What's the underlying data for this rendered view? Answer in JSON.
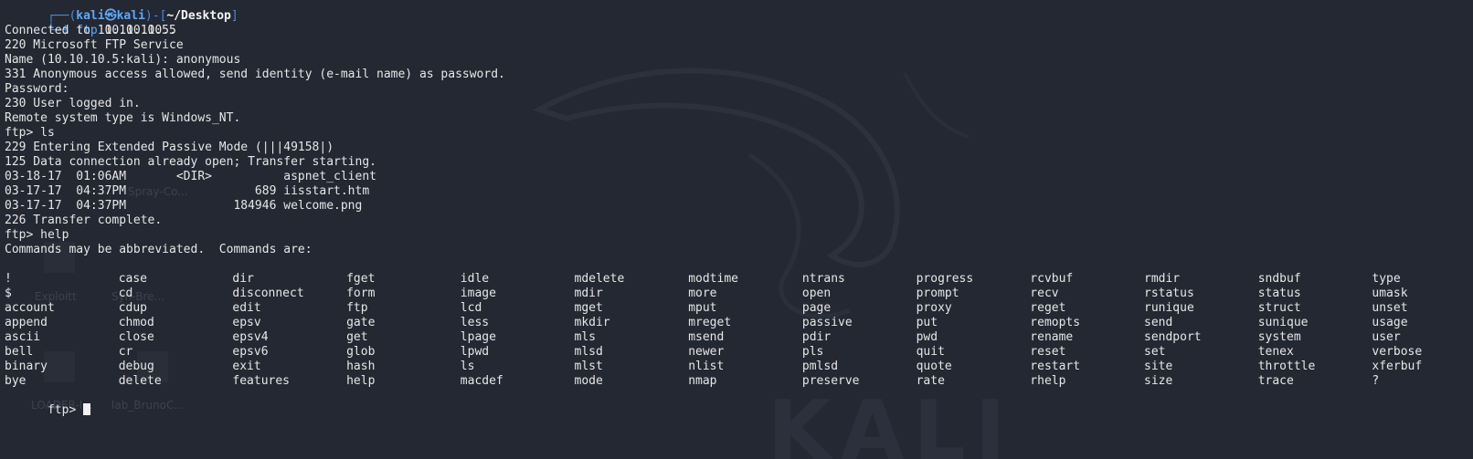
{
  "colors": {
    "background": "#242833",
    "text": "#e6e6e6",
    "prompt_accent": "#3e8fe8",
    "cursor": "#f2f2f2"
  },
  "prompt": {
    "frame_top_left": "┌──(",
    "user": "kali",
    "at_icon": "skull-at-icon",
    "at_glyph": "㉿",
    "host": "kali",
    "frame_mid": ")-[",
    "path": "~/Desktop",
    "frame_close": "]",
    "frame_bottom": "└─",
    "dollar": "$",
    "command": "ftp",
    "command_arg": "10.10.10.5"
  },
  "session": {
    "lines": [
      "Connected to 10.10.10.5.",
      "220 Microsoft FTP Service",
      "Name (10.10.10.5:kali): anonymous",
      "331 Anonymous access allowed, send identity (e-mail name) as password.",
      "Password:",
      "230 User logged in.",
      "Remote system type is Windows_NT.",
      "ftp> ls",
      "229 Entering Extended Passive Mode (|||49158|)",
      "125 Data connection already open; Transfer starting.",
      "03-18-17  01:06AM       <DIR>          aspnet_client",
      "03-17-17  04:37PM                  689 iisstart.htm",
      "03-17-17  04:37PM               184946 welcome.png",
      "226 Transfer complete.",
      "ftp> help",
      "Commands may be abbreviated.  Commands are:",
      ""
    ]
  },
  "help_commands": [
    [
      "!",
      "case",
      "dir",
      "fget",
      "idle",
      "mdelete",
      "modtime",
      "ntrans",
      "progress",
      "rcvbuf",
      "rmdir",
      "sndbuf",
      "type"
    ],
    [
      "$",
      "cd",
      "disconnect",
      "form",
      "image",
      "mdir",
      "more",
      "open",
      "prompt",
      "recv",
      "rstatus",
      "status",
      "umask"
    ],
    [
      "account",
      "cdup",
      "edit",
      "ftp",
      "lcd",
      "mget",
      "mput",
      "page",
      "proxy",
      "reget",
      "runique",
      "struct",
      "unset"
    ],
    [
      "append",
      "chmod",
      "epsv",
      "gate",
      "less",
      "mkdir",
      "mreget",
      "passive",
      "put",
      "remopts",
      "send",
      "sunique",
      "usage"
    ],
    [
      "ascii",
      "close",
      "epsv4",
      "get",
      "lpage",
      "mls",
      "msend",
      "pdir",
      "pwd",
      "rename",
      "sendport",
      "system",
      "user"
    ],
    [
      "bell",
      "cr",
      "epsv6",
      "glob",
      "lpwd",
      "mlsd",
      "newer",
      "pls",
      "quit",
      "reset",
      "set",
      "tenex",
      "verbose"
    ],
    [
      "binary",
      "debug",
      "exit",
      "hash",
      "ls",
      "mlst",
      "nlist",
      "pmlsd",
      "quote",
      "restart",
      "site",
      "throttle",
      "xferbuf"
    ],
    [
      "bye",
      "delete",
      "features",
      "help",
      "macdef",
      "mode",
      "nmap",
      "preserve",
      "rate",
      "rhelp",
      "size",
      "trace",
      "?"
    ]
  ],
  "final_prompt": "ftp> ",
  "wallpaper": {
    "logo_text": "KALI",
    "desktop_labels": [
      "Exploitt",
      "Syn-Bre...",
      "Spray-Co...",
      "LOADER-l...",
      "lab_BrunoC..."
    ]
  }
}
